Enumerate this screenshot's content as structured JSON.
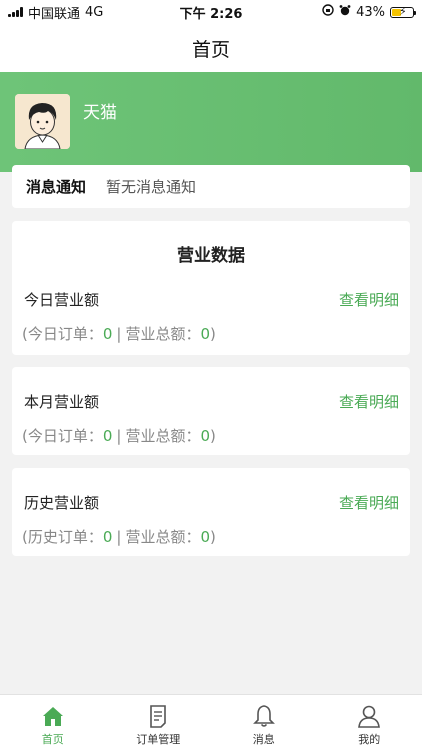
{
  "status_bar": {
    "carrier": "中国联通",
    "network": "4G",
    "time": "下午 2:26",
    "battery": "43%",
    "battery_level": 0.43
  },
  "nav": {
    "title": "首页"
  },
  "header": {
    "shop_name": "天猫"
  },
  "notice": {
    "label": "消息通知",
    "text": "暂无消息通知"
  },
  "business": {
    "title": "营业数据",
    "sections": [
      {
        "title": "今日营业额",
        "link": "查看明细",
        "orders_label": "(今日订单：",
        "orders": "0",
        "sep": "|",
        "total_label": "营业总额：",
        "total": "0",
        "close": ")"
      },
      {
        "title": "本月营业额",
        "link": "查看明细",
        "orders_label": "(今日订单：",
        "orders": "0",
        "sep": "|",
        "total_label": "营业总额：",
        "total": "0",
        "close": ")"
      },
      {
        "title": "历史营业额",
        "link": "查看明细",
        "orders_label": "(历史订单：",
        "orders": "0",
        "sep": "|",
        "total_label": "营业总额：",
        "total": "0",
        "close": ")"
      }
    ]
  },
  "tabs": [
    {
      "label": "首页",
      "icon": "home-icon",
      "active": true
    },
    {
      "label": "订单管理",
      "icon": "document-icon",
      "active": false
    },
    {
      "label": "消息",
      "icon": "bell-icon",
      "active": false
    },
    {
      "label": "我的",
      "icon": "user-icon",
      "active": false
    }
  ],
  "colors": {
    "accent": "#4aaa55",
    "header": "#62b96b",
    "background": "#f2f2f2"
  }
}
